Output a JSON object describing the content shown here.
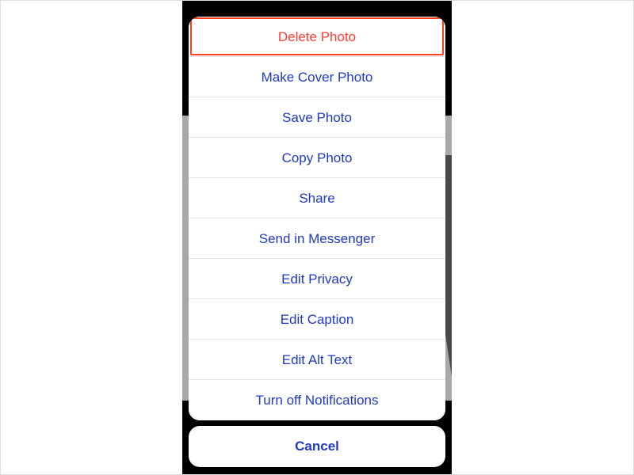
{
  "actionSheet": {
    "options": [
      {
        "label": "Delete Photo",
        "destructive": true,
        "highlighted": true,
        "name": "delete-photo-option"
      },
      {
        "label": "Make Cover Photo",
        "destructive": false,
        "highlighted": false,
        "name": "make-cover-photo-option"
      },
      {
        "label": "Save Photo",
        "destructive": false,
        "highlighted": false,
        "name": "save-photo-option"
      },
      {
        "label": "Copy Photo",
        "destructive": false,
        "highlighted": false,
        "name": "copy-photo-option"
      },
      {
        "label": "Share",
        "destructive": false,
        "highlighted": false,
        "name": "share-option"
      },
      {
        "label": "Send in Messenger",
        "destructive": false,
        "highlighted": false,
        "name": "send-in-messenger-option"
      },
      {
        "label": "Edit Privacy",
        "destructive": false,
        "highlighted": false,
        "name": "edit-privacy-option"
      },
      {
        "label": "Edit Caption",
        "destructive": false,
        "highlighted": false,
        "name": "edit-caption-option"
      },
      {
        "label": "Edit Alt Text",
        "destructive": false,
        "highlighted": false,
        "name": "edit-alt-text-option"
      },
      {
        "label": "Turn off Notifications",
        "destructive": false,
        "highlighted": false,
        "name": "turn-off-notifications-option"
      }
    ],
    "cancelLabel": "Cancel"
  }
}
